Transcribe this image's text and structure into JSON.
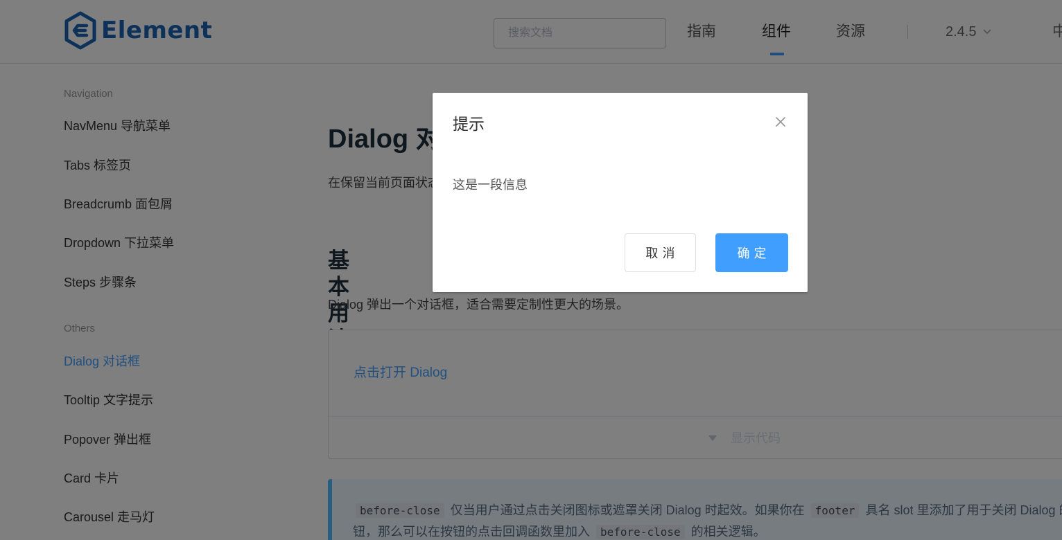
{
  "header": {
    "logo_text": "Element",
    "search_placeholder": "搜索文档",
    "nav": [
      "指南",
      "组件",
      "资源"
    ],
    "active_nav": "组件",
    "version": "2.4.5",
    "lang": "中文"
  },
  "sidebar": {
    "group_navigation": "Navigation",
    "navigation_items": [
      "NavMenu 导航菜单",
      "Tabs 标签页",
      "Breadcrumb 面包屑",
      "Dropdown 下拉菜单",
      "Steps 步骤条"
    ],
    "group_others": "Others",
    "others_items": [
      "Dialog 对话框",
      "Tooltip 文字提示",
      "Popover 弹出框",
      "Card 卡片",
      "Carousel 走马灯"
    ],
    "active_item": "Dialog 对话框"
  },
  "main": {
    "title": "Dialog 对话框",
    "description": "在保留当前页面状态的情况下，告知用户并承载相关操作。",
    "section_title": "基本用法",
    "section_description": "Dialog 弹出一个对话框，适合需要定制性更大的场景。",
    "demo_link": "点击打开 Dialog",
    "show_code": "显示代码",
    "tip": {
      "code1": "before-close",
      "text1": "仅当用户通过点击关闭图标或遮罩关闭 Dialog 时起效。如果你在",
      "code2": "footer",
      "text2": "具名 slot 里添加了用于关闭 Dialog 的按",
      "text3": "钮，那么可以在按钮的点击回调函数里加入",
      "code3": "before-close",
      "text4": "的相关逻辑。"
    }
  },
  "dialog": {
    "title": "提示",
    "body": "这是一段信息",
    "cancel_label": "取消",
    "confirm_label": "确定"
  },
  "colors": {
    "primary": "#409eff",
    "logo": "#1a63b3",
    "overlay": "rgba(0,0,0,0.5)"
  }
}
